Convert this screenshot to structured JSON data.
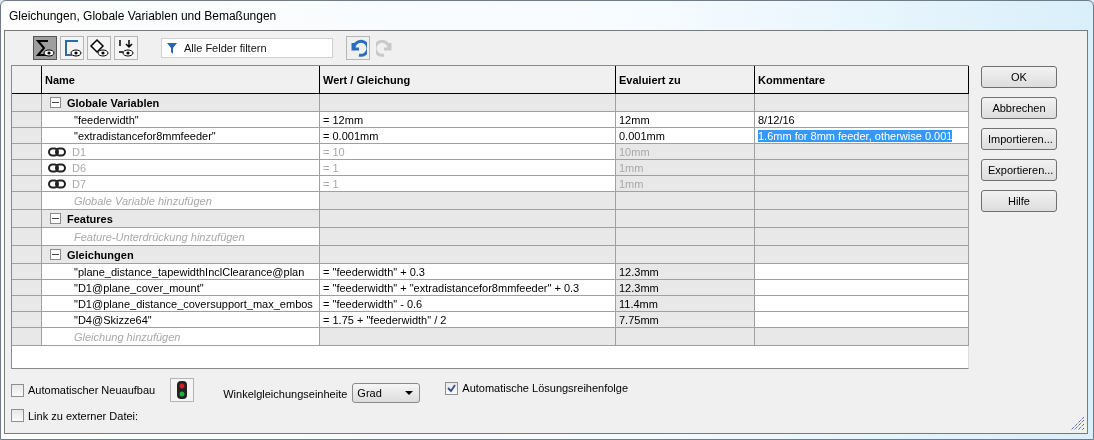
{
  "window": {
    "title": "Gleichungen, Globale Variablen und Bemaßungen"
  },
  "toolbar": {
    "view_buttons": [
      {
        "kind": "sum",
        "pressed": true
      },
      {
        "kind": "sketch",
        "pressed": false
      },
      {
        "kind": "feature",
        "pressed": false
      },
      {
        "kind": "order",
        "pressed": false
      }
    ],
    "filter": {
      "placeholder": "Alle Felder filtern"
    },
    "undo": {
      "disabled": false
    },
    "redo": {
      "disabled": true
    }
  },
  "table": {
    "columns": [
      "Name",
      "Wert / Gleichung",
      "Evaluiert zu",
      "Kommentare"
    ],
    "sections": [
      {
        "title": "Globale Variablen",
        "expanded": true,
        "add_hint": "Globale Variable hinzufügen",
        "rows": [
          {
            "kind": "variable",
            "name": "\"feederwidth\"",
            "value": "= 12mm",
            "evaluated": "12mm",
            "comment": "8/12/16",
            "comment_selected": false
          },
          {
            "kind": "variable",
            "name": "\"extradistancefor8mmfeeder\"",
            "value": "= 0.001mm",
            "evaluated": "0.001mm",
            "comment": "1.6mm for 8mm feeder, otherwise 0.001",
            "comment_selected": true
          },
          {
            "kind": "linked",
            "name": "D1",
            "value": "= 10",
            "evaluated": "10mm"
          },
          {
            "kind": "linked",
            "name": "D6",
            "value": "= 1",
            "evaluated": "1mm"
          },
          {
            "kind": "linked",
            "name": "D7",
            "value": "= 1",
            "evaluated": "1mm"
          }
        ]
      },
      {
        "title": "Features",
        "expanded": true,
        "add_hint": "Feature-Unterdrückung hinzufügen"
      },
      {
        "title": "Gleichungen",
        "expanded": true,
        "add_hint": "Gleichung hinzufügen",
        "rows": [
          {
            "kind": "equation",
            "name": "\"plane_distance_tapewidthInclClearance@plan",
            "value": "= \"feederwidth\" + 0.3",
            "evaluated": "12.3mm"
          },
          {
            "kind": "equation",
            "name": "\"D1@plane_cover_mount\"",
            "value": "= \"feederwidth\" + \"extradistancefor8mmfeeder\" + 0.3",
            "evaluated": "12.3mm"
          },
          {
            "kind": "equation",
            "name": "\"D1@plane_distance_coversupport_max_embos",
            "value": "= \"feederwidth\" - 0.6",
            "evaluated": "11.4mm"
          },
          {
            "kind": "equation",
            "name": "\"D4@Skizze64\"",
            "value": "= 1.75 + \"feederwidth\" / 2",
            "evaluated": "7.75mm"
          }
        ]
      }
    ]
  },
  "buttons": [
    "OK",
    "Abbrechen",
    "Importieren...",
    "Exportieren...",
    "Hilfe"
  ],
  "options": {
    "auto_rebuild": {
      "label": "Automatischer Neuaufbau",
      "checked": false
    },
    "external_link": {
      "label": "Link zu externer Datei:",
      "checked": false
    },
    "angle_unit": {
      "label": "Winkelgleichungseinheite",
      "value": "Grad"
    },
    "auto_order": {
      "label": "Automatische Lösungsreihenfolge",
      "checked": true
    }
  }
}
